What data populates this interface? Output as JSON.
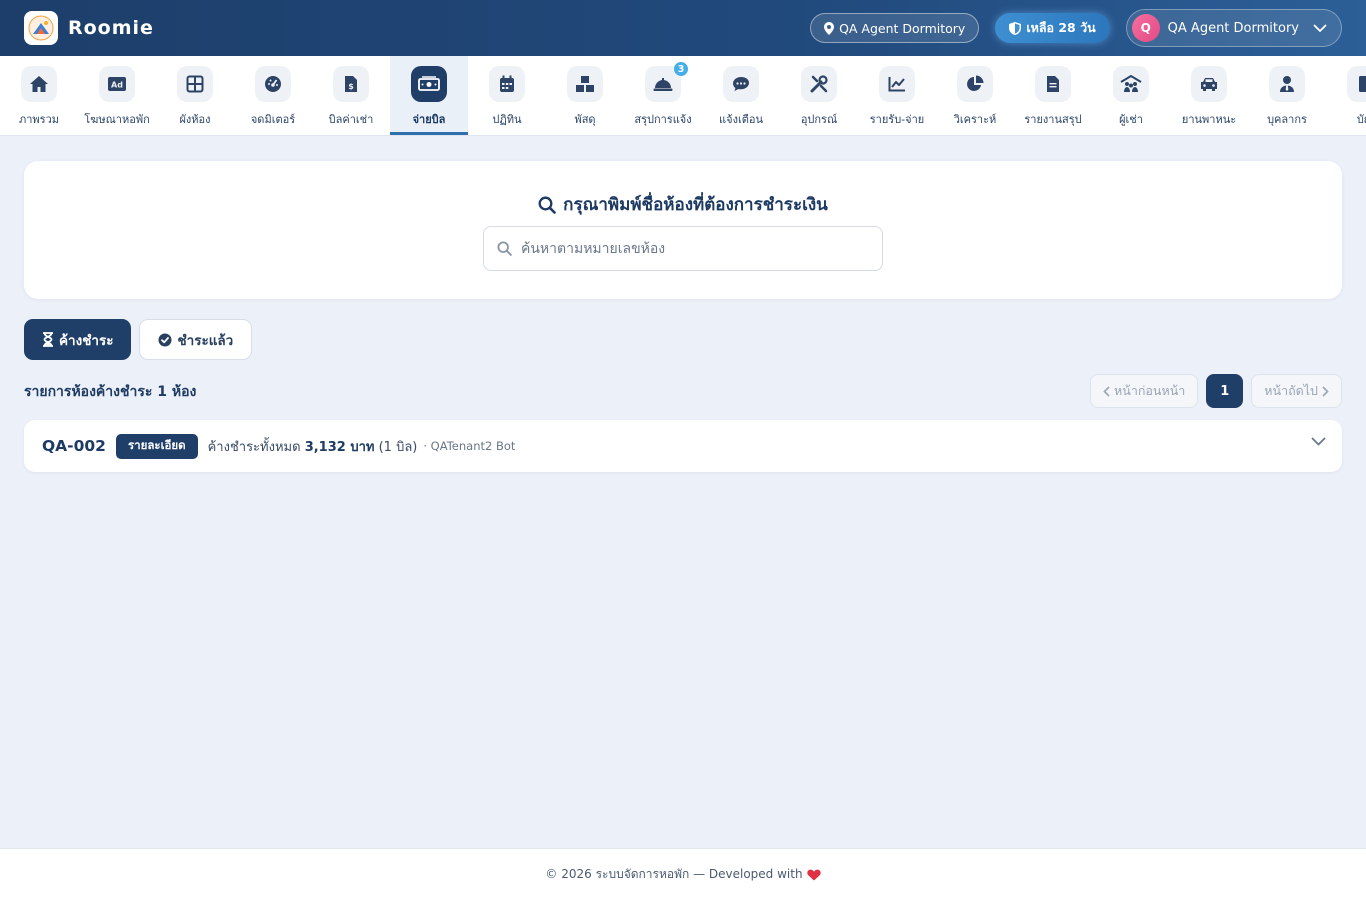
{
  "header": {
    "brand": "Roomie",
    "location": "QA Agent Dormitory",
    "days_left": "เหลือ 28 วัน",
    "user_initial": "Q",
    "user_name": "QA Agent Dormitory"
  },
  "nav": {
    "items": [
      {
        "label": "ภาพรวม",
        "icon": "home-icon"
      },
      {
        "label": "โฆษณาหอพัก",
        "icon": "ad-icon"
      },
      {
        "label": "ผังห้อง",
        "icon": "grid-icon"
      },
      {
        "label": "จดมิเตอร์",
        "icon": "gauge-icon"
      },
      {
        "label": "บิลค่าเช่า",
        "icon": "invoice-icon"
      },
      {
        "label": "จ่ายบิล",
        "icon": "money-icon"
      },
      {
        "label": "ปฏิทิน",
        "icon": "calendar-icon"
      },
      {
        "label": "พัสดุ",
        "icon": "boxes-icon"
      },
      {
        "label": "สรุปการแจ้ง",
        "icon": "bell-icon",
        "badge": "3"
      },
      {
        "label": "แจ้งเตือน",
        "icon": "comment-icon"
      },
      {
        "label": "อุปกรณ์",
        "icon": "tools-icon"
      },
      {
        "label": "รายรับ-จ่าย",
        "icon": "chart-line-icon"
      },
      {
        "label": "วิเคราะห์",
        "icon": "pie-chart-icon"
      },
      {
        "label": "รายงานสรุป",
        "icon": "file-icon"
      },
      {
        "label": "ผู้เช่า",
        "icon": "people-roof-icon"
      },
      {
        "label": "ยานพาหนะ",
        "icon": "car-icon"
      },
      {
        "label": "บุคลากร",
        "icon": "user-tie-icon"
      },
      {
        "label": "บัญ",
        "icon": "book-icon"
      }
    ],
    "active_index": 5
  },
  "search": {
    "title": "กรุณาพิมพ์ชื่อห้องที่ต้องการชำระเงิน",
    "placeholder": "ค้นหาตามหมายเลขห้อง"
  },
  "tabs": {
    "unpaid": "ค้างชำระ",
    "paid": "ชำระแล้ว"
  },
  "list": {
    "title": "รายการห้องค้างชำระ 1 ห้อง",
    "pager": {
      "prev": "หน้าก่อนหน้า",
      "current": "1",
      "next": "หน้าถัดไป"
    },
    "rows": [
      {
        "room": "QA-002",
        "detail_label": "รายละเอียด",
        "summary_prefix": "ค้างชำระทั้งหมด",
        "amount": "3,132 บาท",
        "bill_count": "(1 บิล)",
        "tenant": "· QATenant2 Bot"
      }
    ]
  },
  "footer": {
    "text": "© 2026 ระบบจัดการหอพัก — Developed with"
  },
  "colors": {
    "primary": "#1f3e68",
    "accent": "#2f6fae",
    "heart": "#e03043"
  }
}
